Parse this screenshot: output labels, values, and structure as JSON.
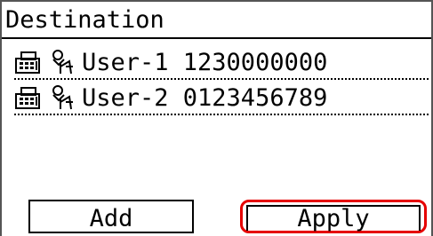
{
  "header": {
    "title": "Destination"
  },
  "destinations": [
    {
      "type_icon": "fax-icon",
      "entry_icon": "address-book-icon",
      "label": "User-1 1230000000"
    },
    {
      "type_icon": "fax-icon",
      "entry_icon": "address-book-icon",
      "label": "User-2 0123456789"
    }
  ],
  "buttons": {
    "add_label": "Add",
    "apply_label": "Apply"
  },
  "colors": {
    "selection_highlight": "#e60000",
    "text": "#000000",
    "background": "#ffffff"
  }
}
